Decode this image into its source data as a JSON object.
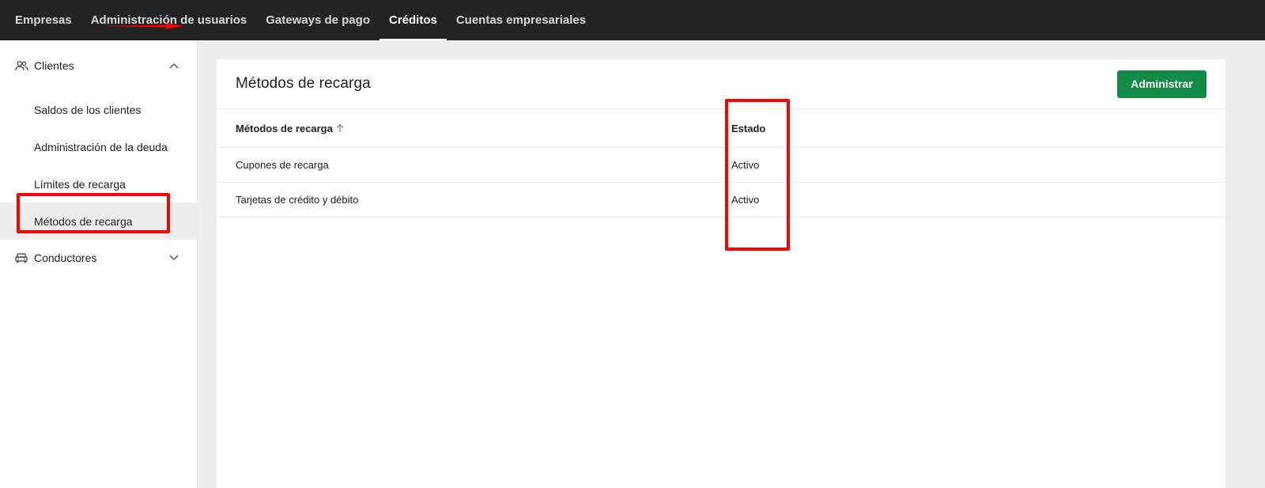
{
  "topnav": {
    "tabs": [
      {
        "label": "Empresas"
      },
      {
        "label": "Administración de usuarios"
      },
      {
        "label": "Gateways de pago"
      },
      {
        "label": "Créditos"
      },
      {
        "label": "Cuentas empresariales"
      }
    ],
    "active_index": 3
  },
  "sidebar": {
    "groups": [
      {
        "label": "Clientes",
        "icon": "people-icon",
        "expanded": true,
        "items": [
          {
            "label": "Saldos de los clientes"
          },
          {
            "label": "Administración de la deuda"
          },
          {
            "label": "Límites de recarga"
          },
          {
            "label": "Métodos de recarga",
            "active": true
          }
        ]
      },
      {
        "label": "Conductores",
        "icon": "car-icon",
        "expanded": false
      }
    ]
  },
  "main": {
    "title": "Métodos de recarga",
    "admin_button": "Administrar",
    "table": {
      "headers": [
        "Métodos de recarga",
        "Estado"
      ],
      "rows": [
        [
          "Cupones de recarga",
          "Activo"
        ],
        [
          "Tarjetas de crédito y débito",
          "Activo"
        ]
      ]
    }
  },
  "colors": {
    "topbar": "#232323",
    "primary_button": "#138a45",
    "annotation": "#ff0000"
  }
}
